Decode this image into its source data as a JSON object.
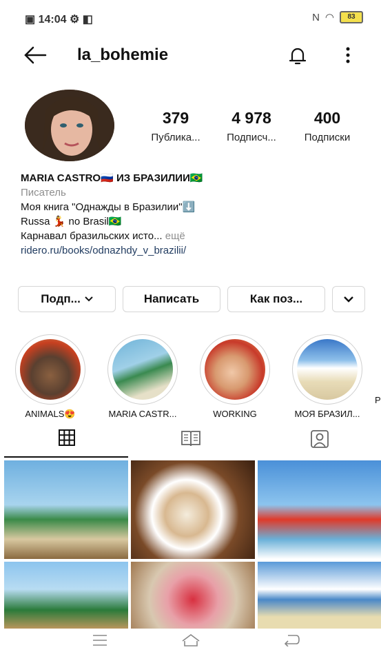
{
  "status": {
    "time": "14:04",
    "battery": "83"
  },
  "header": {
    "username": "la_bohemie"
  },
  "stats": [
    {
      "count": "379",
      "label": "Публика..."
    },
    {
      "count": "4 978",
      "label": "Подписч..."
    },
    {
      "count": "400",
      "label": "Подписки"
    }
  ],
  "bio": {
    "name": "MARIA CASTRO🇷🇺 ИЗ БРАЗИЛИИ🇧🇷",
    "category": "Писатель",
    "line1": "Моя книга \"Однажды в Бразилии\"⬇️",
    "line2": "Russa 💃 no Brasil🇧🇷",
    "line3": "Карнавал бразильских исто...",
    "more": " ещё",
    "link": "ridero.ru/books/odnazhdy_v_brazilii/"
  },
  "actions": {
    "follow": "Подп...",
    "message": "Написать",
    "contact": "Как поз..."
  },
  "highlights": [
    {
      "caption": "ANIMALS😍"
    },
    {
      "caption": "MARIA CASTR..."
    },
    {
      "caption": "WORKING"
    },
    {
      "caption": "МОЯ БРАЗИЛ..."
    },
    {
      "caption": "Р"
    }
  ],
  "icons": {
    "back": "arrow-left-icon",
    "bell": "bell-icon",
    "more": "more-vertical-icon",
    "grid": "grid-icon",
    "guide": "book-icon",
    "tagged": "person-tag-icon"
  }
}
